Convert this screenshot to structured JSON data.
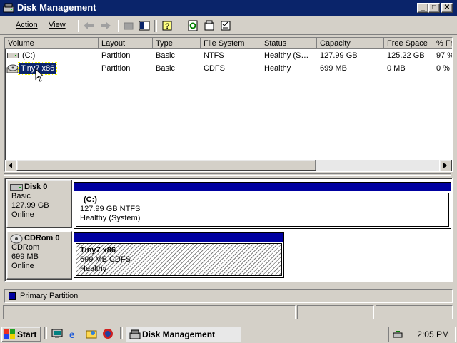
{
  "window": {
    "title": "Disk Management",
    "buttons": {
      "minimize": "_",
      "maximize": "□",
      "close": "✕"
    }
  },
  "menu": {
    "action": "Action",
    "view": "View"
  },
  "columns": [
    "Volume",
    "Layout",
    "Type",
    "File System",
    "Status",
    "Capacity",
    "Free Space",
    "% Fr"
  ],
  "volumes": [
    {
      "volume": "(C:)",
      "layout": "Partition",
      "type": "Basic",
      "fs": "NTFS",
      "status": "Healthy (S…",
      "capacity": "127.99 GB",
      "free": "125.22 GB",
      "pct": "97 %",
      "icon": "drive-icon"
    },
    {
      "volume": "Tiny7 x86",
      "layout": "Partition",
      "type": "Basic",
      "fs": "CDFS",
      "status": "Healthy",
      "capacity": "699 MB",
      "free": "0 MB",
      "pct": "0 %",
      "icon": "cdrom-icon",
      "selected": true
    }
  ],
  "disks": [
    {
      "name": "Disk 0",
      "kind": "Basic",
      "size": "127.99 GB",
      "state": "Online",
      "partition": {
        "label": "(C:)",
        "size_fs": "127.99 GB NTFS",
        "status": "Healthy (System)"
      }
    },
    {
      "name": "CDRom 0",
      "kind": "CDRom",
      "size": "699 MB",
      "state": "Online",
      "partition": {
        "label": "Tiny7 x86",
        "size_fs": "699 MB CDFS",
        "status": "Healthy"
      }
    }
  ],
  "legend": {
    "primary_partition": "Primary Partition",
    "primary_color": "#0000a0"
  },
  "taskbar": {
    "start": "Start",
    "task": "Disk Management",
    "time": "2:05 PM"
  },
  "colors": {
    "titlebar": "#0a246a",
    "selection": "#0a246a",
    "face": "#d4d0c8"
  }
}
